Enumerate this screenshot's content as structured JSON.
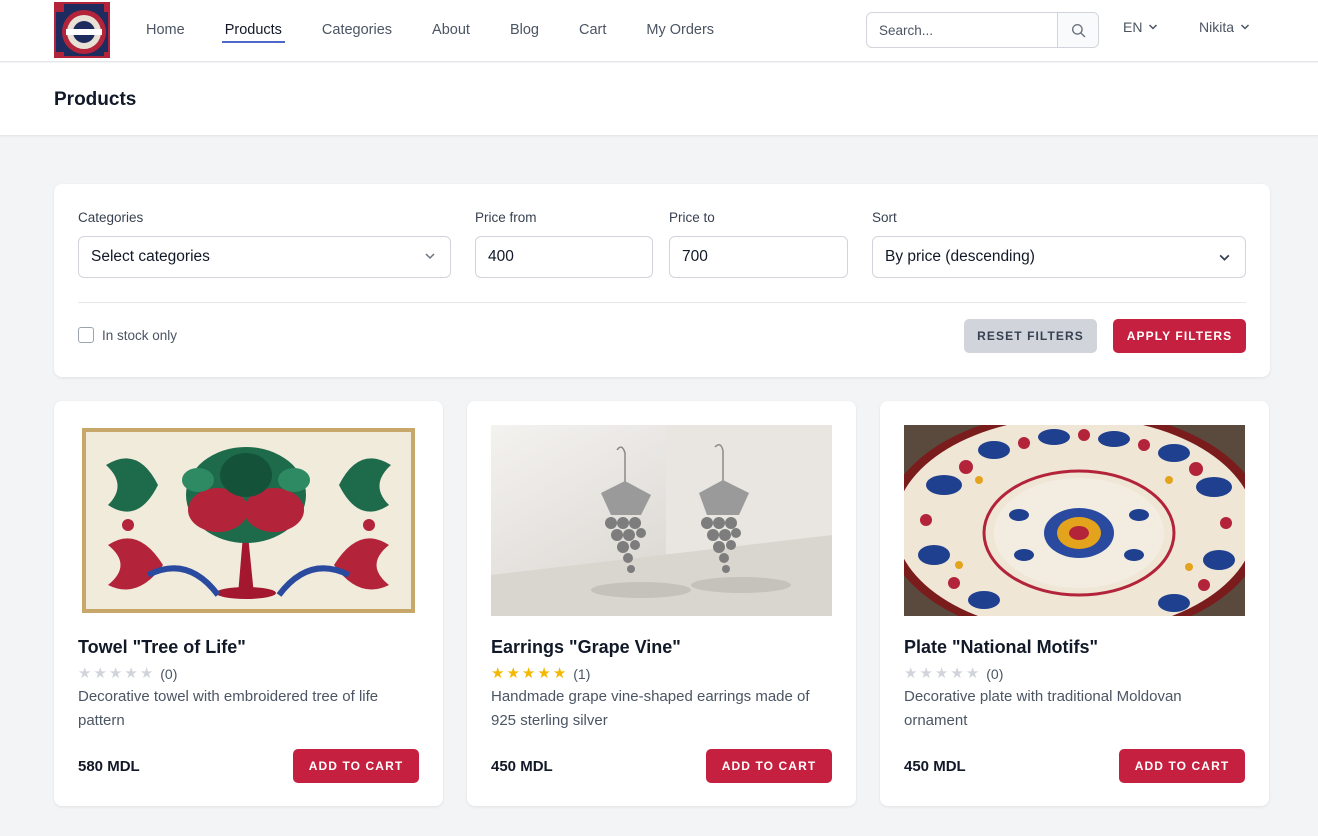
{
  "nav": {
    "links": [
      {
        "label": "Home"
      },
      {
        "label": "Products"
      },
      {
        "label": "Categories"
      },
      {
        "label": "About"
      },
      {
        "label": "Blog"
      },
      {
        "label": "Cart"
      },
      {
        "label": "My Orders"
      }
    ],
    "active": "Products",
    "search_placeholder": "Search...",
    "language": "EN",
    "user": "Nikita"
  },
  "page": {
    "title": "Products"
  },
  "filters": {
    "categories_label": "Categories",
    "categories_value": "Select categories",
    "price_from_label": "Price from",
    "price_from_value": "400",
    "price_to_label": "Price to",
    "price_to_value": "700",
    "sort_label": "Sort",
    "sort_value": "By price (descending)",
    "in_stock_label": "In stock only",
    "in_stock_checked": false,
    "reset_label": "RESET FILTERS",
    "apply_label": "APPLY FILTERS"
  },
  "products": [
    {
      "title": "Towel \"Tree of Life\"",
      "rating": 0,
      "rating_count": "(0)",
      "description": "Decorative towel with embroidered tree of life pattern",
      "price": "580 MDL",
      "button": "ADD TO CART",
      "image": "embroidered-towel-image"
    },
    {
      "title": "Earrings \"Grape Vine\"",
      "rating": 5,
      "rating_count": "(1)",
      "description": "Handmade grape vine-shaped earrings made of 925 sterling silver",
      "price": "450 MDL",
      "button": "ADD TO CART",
      "image": "silver-earrings-image"
    },
    {
      "title": "Plate \"National Motifs\"",
      "rating": 0,
      "rating_count": "(0)",
      "description": "Decorative plate with traditional Moldovan ornament",
      "price": "450 MDL",
      "button": "ADD TO CART",
      "image": "painted-plate-image"
    }
  ],
  "colors": {
    "accent": "#c5203f",
    "active_underline": "#4f67c9",
    "star_on": "#f5b800",
    "star_off": "#d1d5db"
  }
}
